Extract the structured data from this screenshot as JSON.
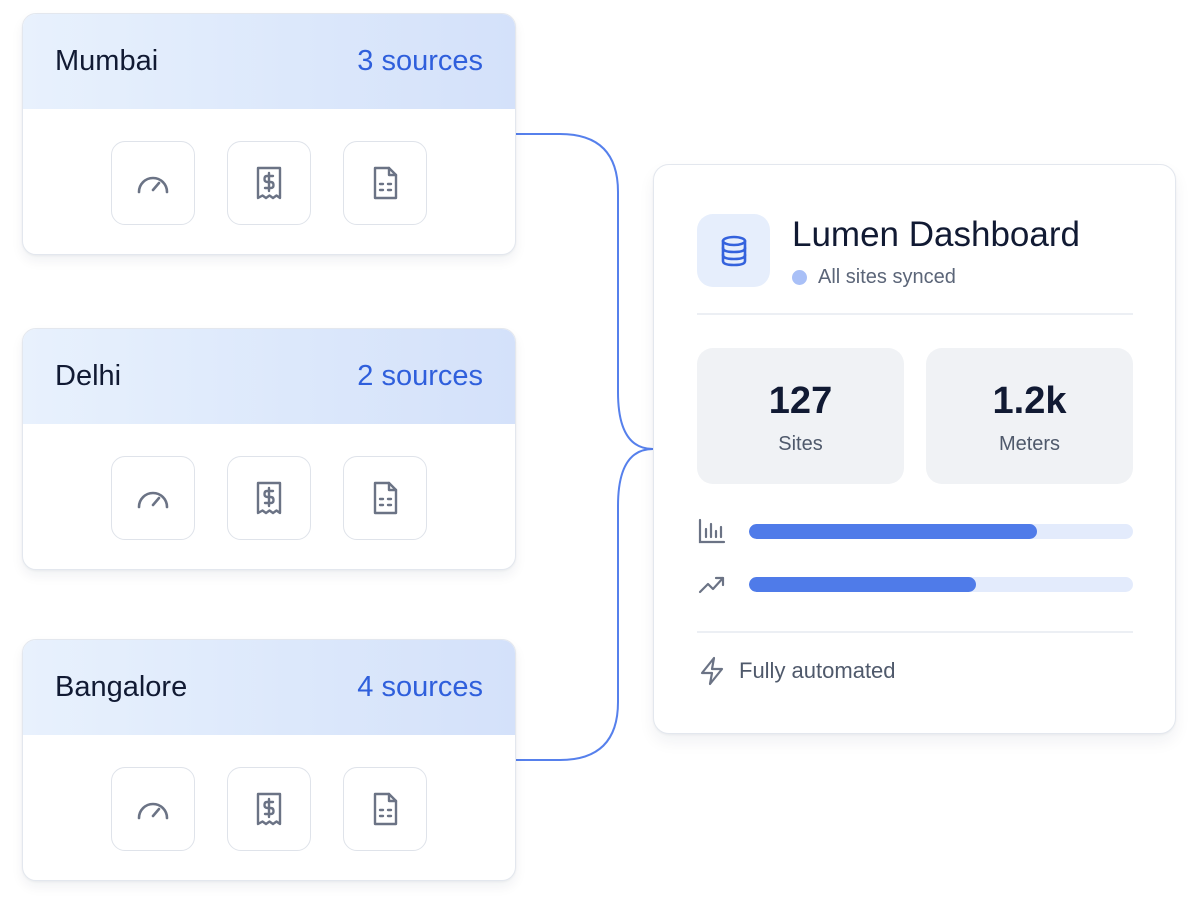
{
  "colors": {
    "accent": "#2f5fdc",
    "connector": "#5680ec",
    "bar_fill": "#4f7be9",
    "bar_track": "#e3ebfc",
    "icon_stroke": "#6b7385",
    "sync_dot": "#a9c0f7"
  },
  "cities": [
    {
      "name": "Mumbai",
      "sources": "3 sources",
      "icons": [
        "speedometer-icon",
        "receipt-icon",
        "document-icon"
      ]
    },
    {
      "name": "Delhi",
      "sources": "2 sources",
      "icons": [
        "speedometer-icon",
        "receipt-icon",
        "document-icon"
      ]
    },
    {
      "name": "Bangalore",
      "sources": "4 sources",
      "icons": [
        "speedometer-icon",
        "receipt-icon",
        "document-icon"
      ]
    }
  ],
  "dashboard": {
    "icon": "database-icon",
    "title": "Lumen Dashboard",
    "status": "All sites synced",
    "stats": [
      {
        "value": "127",
        "label": "Sites"
      },
      {
        "value": "1.2k",
        "label": "Meters"
      }
    ],
    "progress": [
      {
        "icon": "bar-chart-icon",
        "fraction": 0.75
      },
      {
        "icon": "trending-up-icon",
        "fraction": 0.59
      }
    ],
    "footer": {
      "icon": "lightning-icon",
      "label": "Fully automated"
    }
  }
}
